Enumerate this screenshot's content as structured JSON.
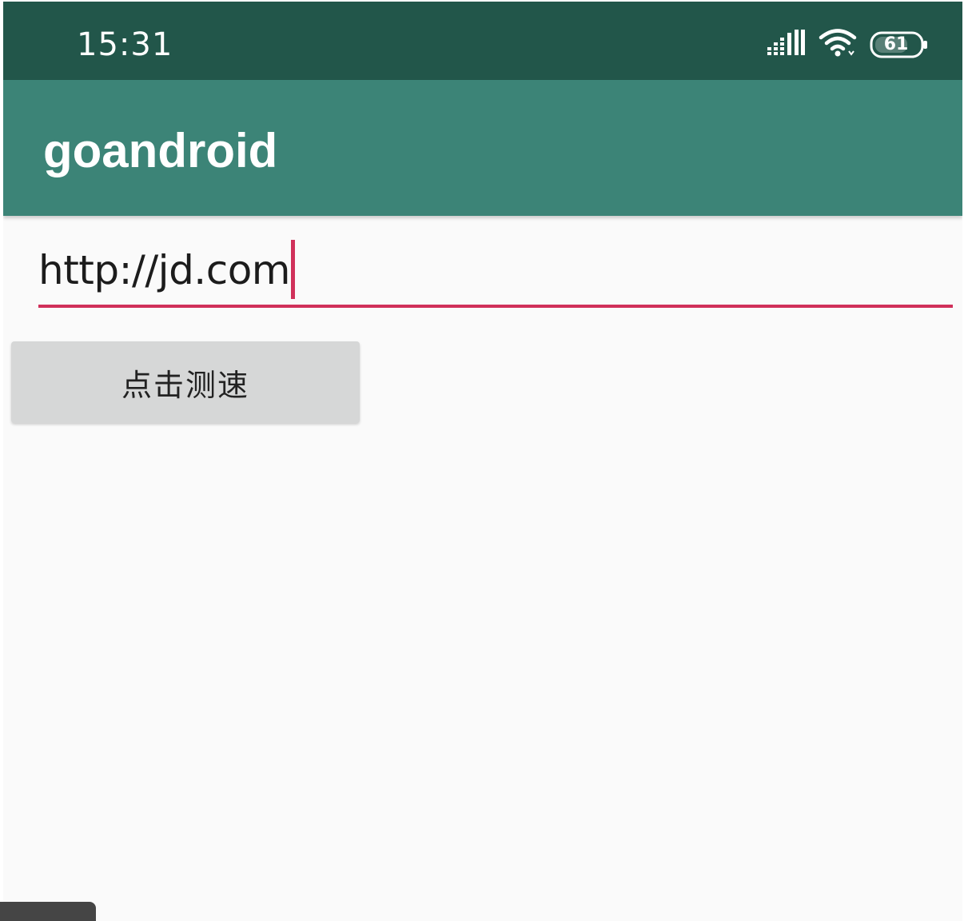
{
  "status_bar": {
    "time": "15:31",
    "battery_level": "61",
    "signal_icon": "cellular-signal-icon",
    "wifi_icon": "wifi-icon",
    "battery_icon": "battery-icon"
  },
  "app_bar": {
    "title": "goandroid"
  },
  "url_input": {
    "value": "http://jd.com"
  },
  "speed_test_button": {
    "label": "点击测速"
  },
  "colors": {
    "status_bar": "#22564a",
    "app_bar": "#3c8477",
    "accent": "#d0305a",
    "background": "#fafafa",
    "button": "#d6d7d7"
  }
}
